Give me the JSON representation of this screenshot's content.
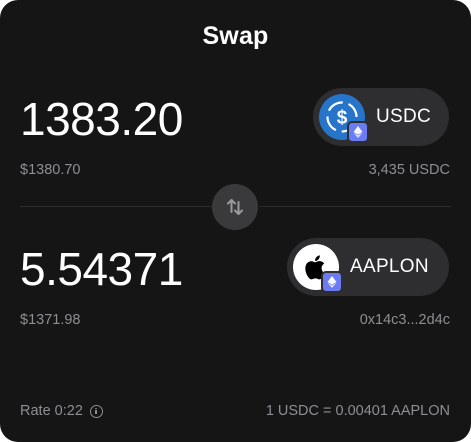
{
  "header": {
    "title": "Swap"
  },
  "from": {
    "amount": "1383.20",
    "fiat_value": "$1380.70",
    "balance": "3,435 USDC",
    "token": {
      "symbol": "USDC",
      "icon": "usdc-icon",
      "chain_icon": "ethereum-icon",
      "color": "#2775ca"
    }
  },
  "to": {
    "amount": "5.54371",
    "fiat_value": "$1371.98",
    "address": "0x14c3...2d4c",
    "token": {
      "symbol": "AAPLON",
      "icon": "apple-icon",
      "chain_icon": "ethereum-icon",
      "color": "#ffffff"
    }
  },
  "swap_direction_icon": "swap-arrows-icon",
  "footer": {
    "rate_label": "Rate 0:22",
    "rate_value": "1 USDC = 0.00401 AAPLON"
  },
  "colors": {
    "background": "#151516",
    "pill": "#2e2e30",
    "muted_text": "#8e8e93",
    "chain_badge": "#6b7bf2"
  }
}
